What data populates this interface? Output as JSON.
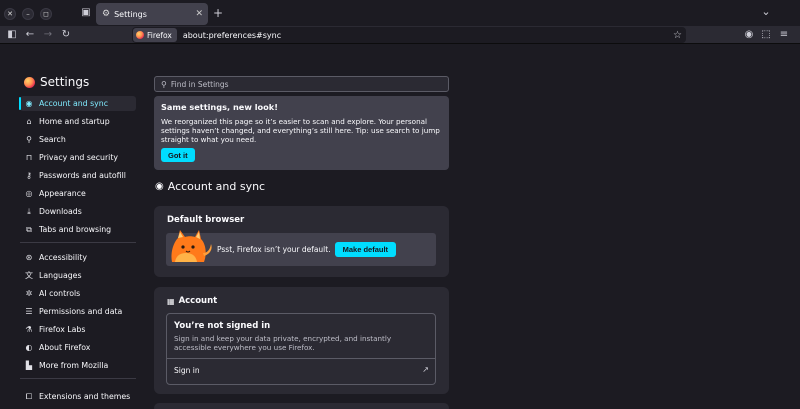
{
  "tabstrip": {
    "tab_title": "Settings",
    "new_tab_symbol": "+",
    "list_all_symbol": "⌄"
  },
  "navbar": {
    "identity_label": "Firefox",
    "url": "about:preferences#sync"
  },
  "sidebar": {
    "title": "Settings",
    "items": [
      {
        "label": "Account and sync",
        "icon": "account-icon"
      },
      {
        "label": "Home and startup",
        "icon": "home-icon"
      },
      {
        "label": "Search",
        "icon": "search-icon"
      },
      {
        "label": "Privacy and security",
        "icon": "lock-icon"
      },
      {
        "label": "Passwords and autofill",
        "icon": "key-icon"
      },
      {
        "label": "Appearance",
        "icon": "eye-icon"
      },
      {
        "label": "Downloads",
        "icon": "download-icon"
      },
      {
        "label": "Tabs and browsing",
        "icon": "tabs-icon"
      },
      {
        "label": "Accessibility",
        "icon": "accessibility-icon"
      },
      {
        "label": "Languages",
        "icon": "language-icon"
      },
      {
        "label": "AI controls",
        "icon": "sparkle-icon"
      },
      {
        "label": "Permissions and data",
        "icon": "permissions-icon"
      },
      {
        "label": "Firefox Labs",
        "icon": "flask-icon"
      },
      {
        "label": "About Firefox",
        "icon": "firefox-icon"
      },
      {
        "label": "More from Mozilla",
        "icon": "mozilla-icon"
      },
      {
        "label": "Extensions and themes",
        "icon": "puzzle-icon"
      }
    ]
  },
  "search": {
    "placeholder": "Find in Settings"
  },
  "notice": {
    "title": "Same settings, new look!",
    "body": "We reorganized this page so it’s easier to scan and explore. Your personal settings haven’t changed, and everything’s still here. Tip: use search to jump straight to what you need.",
    "button": "Got it"
  },
  "main": {
    "section_title": "Account and sync",
    "default_browser": {
      "title": "Default browser",
      "message": "Psst, Firefox isn’t your default.",
      "button": "Make default"
    },
    "account": {
      "title": "Account",
      "heading": "You’re not signed in",
      "description": "Sign in and keep your data private, encrypted, and instantly accessible everywhere you use Firefox.",
      "signin_label": "Sign in"
    }
  },
  "colors": {
    "accent": "#00ddff",
    "background": "#1c1b22",
    "card": "#2b2a33"
  }
}
